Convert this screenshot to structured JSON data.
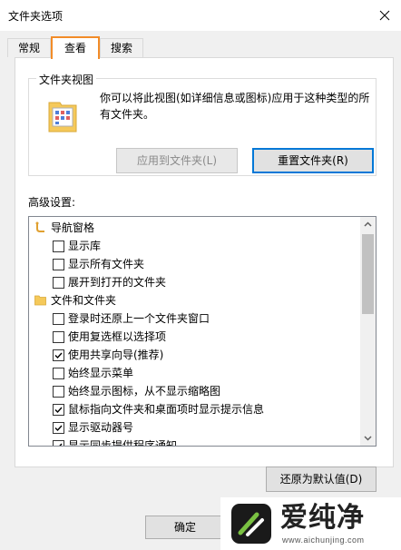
{
  "window": {
    "title": "文件夹选项"
  },
  "tabs": [
    {
      "label": "常规"
    },
    {
      "label": "查看"
    },
    {
      "label": "搜索"
    }
  ],
  "folder_views": {
    "group_title": "文件夹视图",
    "description": "你可以将此视图(如详细信息或图标)应用于这种类型的所有文件夹。",
    "apply_label": "应用到文件夹(L)",
    "reset_label": "重置文件夹(R)"
  },
  "advanced": {
    "label": "高级设置:",
    "items": [
      {
        "type": "group",
        "icon": "navigation-pane-icon",
        "label": "导航窗格"
      },
      {
        "type": "checkbox",
        "checked": false,
        "label": "显示库"
      },
      {
        "type": "checkbox",
        "checked": false,
        "label": "显示所有文件夹"
      },
      {
        "type": "checkbox",
        "checked": false,
        "label": "展开到打开的文件夹"
      },
      {
        "type": "group",
        "icon": "folder-icon",
        "label": "文件和文件夹"
      },
      {
        "type": "checkbox",
        "checked": false,
        "label": "登录时还原上一个文件夹窗口"
      },
      {
        "type": "checkbox",
        "checked": false,
        "label": "使用复选框以选择项"
      },
      {
        "type": "checkbox",
        "checked": true,
        "label": "使用共享向导(推荐)"
      },
      {
        "type": "checkbox",
        "checked": false,
        "label": "始终显示菜单"
      },
      {
        "type": "checkbox",
        "checked": false,
        "label": "始终显示图标，从不显示缩略图"
      },
      {
        "type": "checkbox",
        "checked": true,
        "label": "鼠标指向文件夹和桌面项时显示提示信息"
      },
      {
        "type": "checkbox",
        "checked": true,
        "label": "显示驱动器号"
      },
      {
        "type": "checkbox",
        "checked": true,
        "label": "显示同步提供程序通知"
      }
    ],
    "restore_label": "还原为默认值(D)"
  },
  "footer": {
    "ok_label": "确定"
  },
  "watermark": {
    "brand": "爱纯净",
    "url": "www.aichunjing.com"
  },
  "colors": {
    "tab_highlight": "#f28c28",
    "focus_border": "#0078d7",
    "folder": "#f5c95a"
  }
}
